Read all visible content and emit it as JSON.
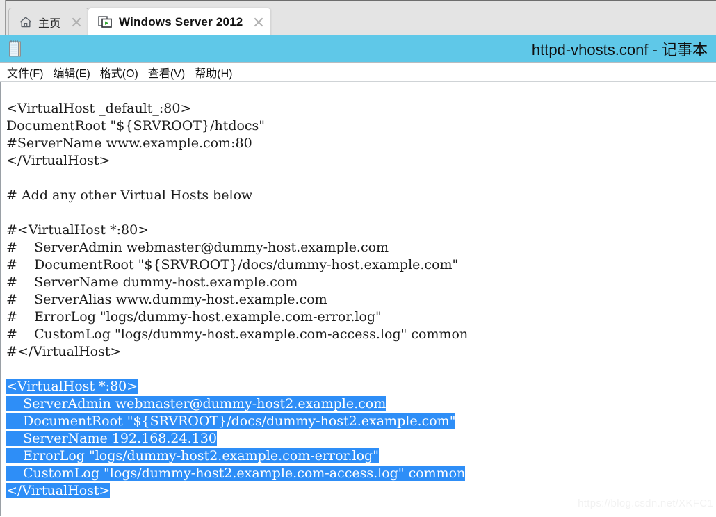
{
  "tabbar": {
    "tabs": [
      {
        "label": "主页",
        "icon": "home-icon",
        "active": false,
        "close_icon": "close-icon"
      },
      {
        "label": "Windows Server 2012",
        "icon": "remote-desktop-icon",
        "active": true,
        "close_icon": "close-icon"
      }
    ]
  },
  "notepad": {
    "icon": "notepad-icon",
    "title": "httpd-vhosts.conf - 记事本",
    "titlebar_color": "#5fc8e8",
    "selection_color": "#2e8ef7",
    "menu": [
      {
        "label": "文件(F)"
      },
      {
        "label": "编辑(E)"
      },
      {
        "label": "格式(O)"
      },
      {
        "label": "查看(V)"
      },
      {
        "label": "帮助(H)"
      }
    ],
    "document": {
      "filename": "httpd-vhosts.conf",
      "lines": [
        {
          "text": "<VirtualHost _default_:80>",
          "selected": false
        },
        {
          "text": "DocumentRoot \"${SRVROOT}/htdocs\"",
          "selected": false
        },
        {
          "text": "#ServerName www.example.com:80",
          "selected": false
        },
        {
          "text": "</VirtualHost>",
          "selected": false
        },
        {
          "text": "",
          "selected": false
        },
        {
          "text": "# Add any other Virtual Hosts below",
          "selected": false
        },
        {
          "text": "",
          "selected": false
        },
        {
          "text": "#<VirtualHost *:80>",
          "selected": false
        },
        {
          "text": "#    ServerAdmin webmaster@dummy-host.example.com",
          "selected": false
        },
        {
          "text": "#    DocumentRoot \"${SRVROOT}/docs/dummy-host.example.com\"",
          "selected": false
        },
        {
          "text": "#    ServerName dummy-host.example.com",
          "selected": false
        },
        {
          "text": "#    ServerAlias www.dummy-host.example.com",
          "selected": false
        },
        {
          "text": "#    ErrorLog \"logs/dummy-host.example.com-error.log\"",
          "selected": false
        },
        {
          "text": "#    CustomLog \"logs/dummy-host.example.com-access.log\" common",
          "selected": false
        },
        {
          "text": "#</VirtualHost>",
          "selected": false
        },
        {
          "text": "",
          "selected": false
        },
        {
          "text": "<VirtualHost *:80>",
          "selected": true
        },
        {
          "text": "    ServerAdmin webmaster@dummy-host2.example.com",
          "selected": true
        },
        {
          "text": "    DocumentRoot \"${SRVROOT}/docs/dummy-host2.example.com\"",
          "selected": true
        },
        {
          "text": "    ServerName 192.168.24.130",
          "selected": true
        },
        {
          "text": "    ErrorLog \"logs/dummy-host2.example.com-error.log\"",
          "selected": true
        },
        {
          "text": "    CustomLog \"logs/dummy-host2.example.com-access.log\" common",
          "selected": true
        },
        {
          "text": "</VirtualHost>",
          "selected": true
        }
      ]
    }
  },
  "watermark": {
    "text": "https://blog.csdn.net/XKFC1"
  }
}
